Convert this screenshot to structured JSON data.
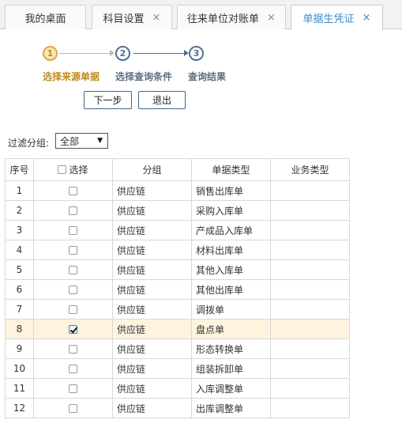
{
  "tabs": [
    {
      "label": "我的桌面",
      "closable": false,
      "active": false
    },
    {
      "label": "科目设置",
      "closable": true,
      "active": false
    },
    {
      "label": "往来单位对账单",
      "closable": true,
      "active": false
    },
    {
      "label": "单据生凭证",
      "closable": true,
      "active": true
    }
  ],
  "close_glyph": "×",
  "steps": [
    {
      "number": "1",
      "label": "选择来源单据",
      "state": "done"
    },
    {
      "number": "2",
      "label": "选择查询条件",
      "state": "todo"
    },
    {
      "number": "3",
      "label": "查询结果",
      "state": "todo"
    }
  ],
  "buttons": {
    "next_label": "下一步",
    "exit_label": "退出"
  },
  "filter": {
    "label": "过滤分组:",
    "selected": "全部"
  },
  "colors": {
    "accent": "#3c8dcc",
    "step_done": "#e0a93a",
    "step_todo": "#4f6f94",
    "selected_row": "#fdf3df"
  },
  "table": {
    "headers": {
      "index": "序号",
      "select": "选择",
      "group": "分组",
      "doc_type": "单据类型",
      "biz_type": "业务类型"
    },
    "rows": [
      {
        "index": "1",
        "checked": false,
        "group": "供应链",
        "doc_type": "销售出库单",
        "biz_type": ""
      },
      {
        "index": "2",
        "checked": false,
        "group": "供应链",
        "doc_type": "采购入库单",
        "biz_type": ""
      },
      {
        "index": "3",
        "checked": false,
        "group": "供应链",
        "doc_type": "产成品入库单",
        "biz_type": ""
      },
      {
        "index": "4",
        "checked": false,
        "group": "供应链",
        "doc_type": "材料出库单",
        "biz_type": ""
      },
      {
        "index": "5",
        "checked": false,
        "group": "供应链",
        "doc_type": "其他入库单",
        "biz_type": ""
      },
      {
        "index": "6",
        "checked": false,
        "group": "供应链",
        "doc_type": "其他出库单",
        "biz_type": ""
      },
      {
        "index": "7",
        "checked": false,
        "group": "供应链",
        "doc_type": "调拨单",
        "biz_type": ""
      },
      {
        "index": "8",
        "checked": true,
        "group": "供应链",
        "doc_type": "盘点单",
        "biz_type": ""
      },
      {
        "index": "9",
        "checked": false,
        "group": "供应链",
        "doc_type": "形态转换单",
        "biz_type": ""
      },
      {
        "index": "10",
        "checked": false,
        "group": "供应链",
        "doc_type": "组装拆卸单",
        "biz_type": ""
      },
      {
        "index": "11",
        "checked": false,
        "group": "供应链",
        "doc_type": "入库调整单",
        "biz_type": ""
      },
      {
        "index": "12",
        "checked": false,
        "group": "供应链",
        "doc_type": "出库调整单",
        "biz_type": ""
      }
    ]
  }
}
